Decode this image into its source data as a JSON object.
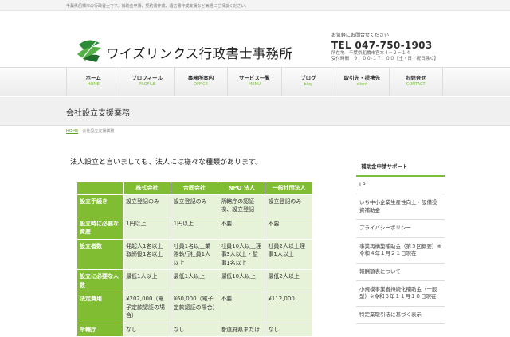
{
  "topbar": {
    "text": "千葉県船橋市の行政書士です。補助金申請、契約書作成、遺言書作成支援など気軽にご相談ください。"
  },
  "header": {
    "site_title": "ワイズリンクス行政書士事務所",
    "contact_label": "お気軽にお問合せください",
    "tel": "TEL 047-750-1903",
    "address": "所在地　千葉県船橋市宮本４－２－１４",
    "hours": "受付時間　９：００-１７：００【土・日・祝日除く】"
  },
  "nav": [
    {
      "label": "ホーム",
      "sub": "HOME"
    },
    {
      "label": "プロフィール",
      "sub": "PROFILE"
    },
    {
      "label": "事務所案内",
      "sub": "OFFICE"
    },
    {
      "label": "サービス一覧",
      "sub": "MENU"
    },
    {
      "label": "ブログ",
      "sub": "blog"
    },
    {
      "label": "取引先・提携先",
      "sub": "client"
    },
    {
      "label": "お問合せ",
      "sub": "CONTACT"
    }
  ],
  "page_title": "会社設立支援業務",
  "breadcrumb": {
    "home": "HOME",
    "separator": " › ",
    "current": "会社設立支援業務"
  },
  "lead": "法人設立と言いましても、法人には様々な種類があります。",
  "table": {
    "headers": [
      "",
      "株式会社",
      "合同会社",
      "NPO 法人",
      "一般社団法人"
    ],
    "rows": [
      [
        "設立手続き",
        "設立登記のみ",
        "設立登記のみ",
        "所轄庁の認証後、設立登記",
        "設立登記のみ"
      ],
      [
        "設立時に必要な資産",
        "1円以上",
        "1円以上",
        "不要",
        "不要"
      ],
      [
        "設立者数",
        "発起人1名以上取締役1名以上",
        "社員1名以上業務執行社員1人以上",
        "社員10人以上理事3人以上・監事1名以上",
        "社員2人以上理事1人以上"
      ],
      [
        "設立に必要な人数",
        "最低1人以上",
        "最低1人以上",
        "最低10人以上",
        "最低2人以上"
      ],
      [
        "法定費用",
        "¥202,000（電子定款認証の場合）",
        "¥60,000（電子定款認証の場合）",
        "不要",
        "¥112,000"
      ],
      [
        "所轄庁",
        "なし",
        "なし",
        "都道府県または",
        "なし"
      ]
    ]
  },
  "sidebar": {
    "title": "補助金申請サポート",
    "items": [
      "LP",
      "いち中小企業生産性向上・設備投資補助金",
      "プライバシーポリシー",
      "事業再構築補助金（第５回概要）※令和４年１月２１日現在",
      "報酬額表について",
      "小規模事業者持続化補助金（一般型）※令和３年１１月１８日現在",
      "特定業取引法に基づく表示"
    ]
  },
  "colors": {
    "accent": "#80bd33",
    "cell_bg": "#e7f3d8"
  }
}
